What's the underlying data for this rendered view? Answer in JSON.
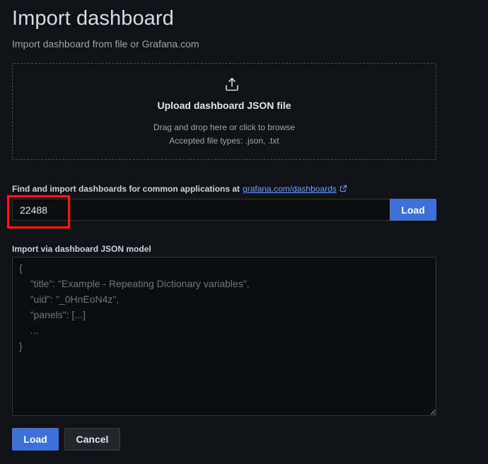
{
  "header": {
    "title": "Import dashboard",
    "subtitle": "Import dashboard from file or Grafana.com"
  },
  "upload": {
    "title": "Upload dashboard JSON file",
    "hint": "Drag and drop here or click to browse",
    "accepted": "Accepted file types: .json, .txt",
    "icon": "upload-icon"
  },
  "grafana_import": {
    "label": "Find and import dashboards for common applications at",
    "link_text": "grafana.com/dashboards",
    "link_icon": "external-link-icon",
    "input_value": "22488",
    "load_label": "Load"
  },
  "json_model": {
    "label": "Import via dashboard JSON model",
    "placeholder": "{\n    \"title\": \"Example - Repeating Dictionary variables\",\n    \"uid\": \"_0HnEoN4z\",\n    \"panels\": [...]\n    ...\n}"
  },
  "actions": {
    "load_label": "Load",
    "cancel_label": "Cancel"
  },
  "colors": {
    "background": "#111217",
    "primary": "#3d71d9",
    "link": "#6e9fff",
    "highlight": "#e3221f"
  }
}
